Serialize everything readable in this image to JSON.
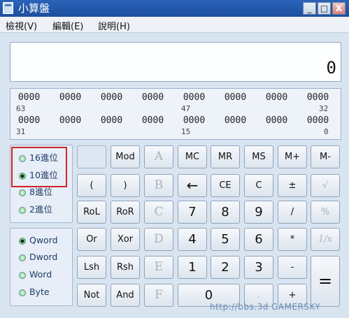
{
  "window": {
    "title": "小算盤",
    "minimize_label": "_",
    "maximize_label": "□",
    "close_label": "X"
  },
  "menu": [
    "檢視(V)",
    "編輯(E)",
    "說明(H)"
  ],
  "display": {
    "value": "0"
  },
  "bit_display": {
    "row1": [
      "0000",
      "0000",
      "0000",
      "0000",
      "0000",
      "0000",
      "0000",
      "0000"
    ],
    "row1_indices": [
      "63",
      "47",
      "32"
    ],
    "row2": [
      "0000",
      "0000",
      "0000",
      "0000",
      "0000",
      "0000",
      "0000",
      "0000"
    ],
    "row2_indices": [
      "31",
      "15",
      "0"
    ]
  },
  "base": {
    "options": [
      "16進位",
      "10進位",
      "8進位",
      "2進位"
    ],
    "selected": "10進位"
  },
  "word_size": {
    "options": [
      "Qword",
      "Dword",
      "Word",
      "Byte"
    ],
    "selected": "Qword"
  },
  "keys": {
    "r1": [
      "Mod",
      "A",
      "MC",
      "MR",
      "MS",
      "M+",
      "M-"
    ],
    "r2": [
      "(",
      ")",
      "B",
      "←",
      "CE",
      "C",
      "±",
      "√"
    ],
    "r3": [
      "RoL",
      "RoR",
      "C",
      "7",
      "8",
      "9",
      "/",
      "%"
    ],
    "r4": [
      "Or",
      "Xor",
      "D",
      "4",
      "5",
      "6",
      "*",
      "1/x"
    ],
    "r5": [
      "Lsh",
      "Rsh",
      "E",
      "1",
      "2",
      "3",
      "-",
      "="
    ],
    "r6": [
      "Not",
      "And",
      "F",
      "0",
      ".",
      "+"
    ]
  },
  "watermark": "http://bbs.3d GAMERSKY"
}
